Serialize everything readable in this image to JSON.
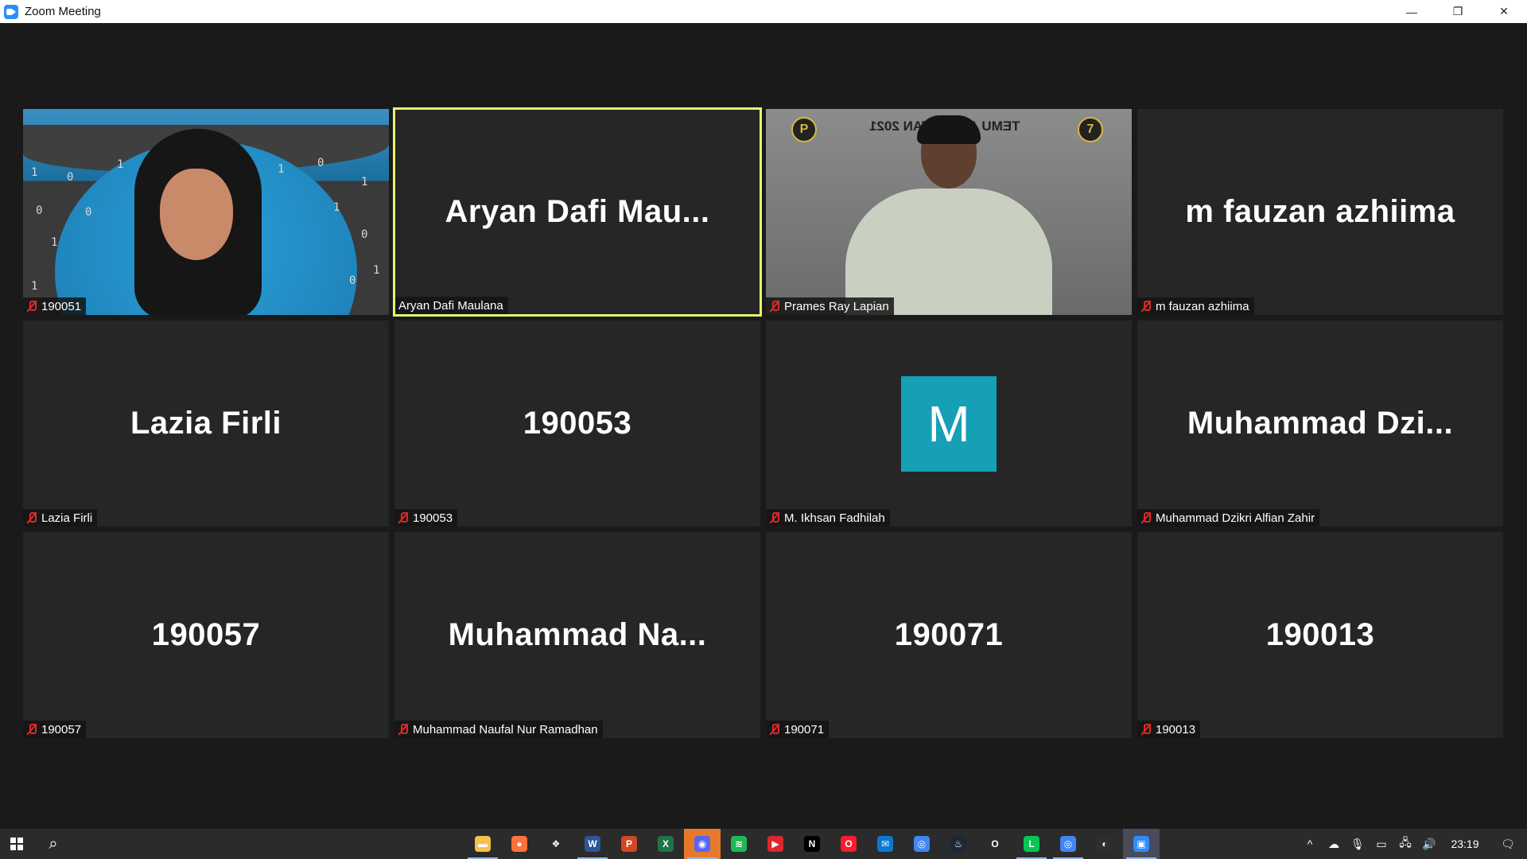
{
  "window": {
    "title": "Zoom Meeting",
    "controls": {
      "minimize": "—",
      "restore": "❐",
      "close": "✕"
    }
  },
  "participants": [
    {
      "big_label": "",
      "name": "190051",
      "type": "video",
      "muted": true
    },
    {
      "big_label": "Aryan  Dafi  Mau...",
      "name": "Aryan Dafi Maulana",
      "type": "name",
      "muted": false,
      "active_speaker": true
    },
    {
      "big_label": "",
      "name": "Prames Ray Lapian",
      "type": "video",
      "muted": true
    },
    {
      "big_label": "m fauzan azhiima",
      "name": "m fauzan azhiima",
      "type": "name",
      "muted": true
    },
    {
      "big_label": "Lazia Firli",
      "name": "Lazia Firli",
      "type": "name",
      "muted": true
    },
    {
      "big_label": "190053",
      "name": "190053",
      "type": "name",
      "muted": true
    },
    {
      "big_label": "M",
      "name": "M. Ikhsan Fadhilah",
      "type": "avatar",
      "muted": true
    },
    {
      "big_label": "Muhammad  Dzi...",
      "name": "Muhammad Dzikri Alfian Zahir",
      "type": "name",
      "muted": true
    },
    {
      "big_label": "190057",
      "name": "190057",
      "type": "name",
      "muted": true
    },
    {
      "big_label": "Muhammad  Na...",
      "name": "Muhammad Naufal Nur Ramadhan",
      "type": "name",
      "muted": true
    },
    {
      "big_label": "190071",
      "name": "190071",
      "type": "name",
      "muted": true
    },
    {
      "big_label": "190013",
      "name": "190013",
      "type": "name",
      "muted": true
    }
  ],
  "video_text": {
    "tile1_digits": [
      "1",
      "0",
      "1",
      "1",
      "0",
      "1",
      "0",
      "0",
      "1",
      "1",
      "0",
      "1",
      "1",
      "0"
    ],
    "tile3_banner": "TEMU ANGKATAN 2021",
    "tile3_badge_left": "P",
    "tile3_badge_right": "7"
  },
  "taskbar": {
    "apps": [
      {
        "name": "file-explorer-icon",
        "color": "#f2c14e",
        "glyph": "▬",
        "running": true
      },
      {
        "name": "firefox-icon",
        "color": "#ff7139",
        "glyph": "●",
        "running": false
      },
      {
        "name": "dropbox-icon",
        "color": "#2b2b2b",
        "glyph": "❖",
        "running": false
      },
      {
        "name": "word-icon",
        "color": "#2b579a",
        "glyph": "W",
        "running": true
      },
      {
        "name": "powerpoint-icon",
        "color": "#d24726",
        "glyph": "P",
        "running": false
      },
      {
        "name": "excel-icon",
        "color": "#217346",
        "glyph": "X",
        "running": false
      },
      {
        "name": "discord-icon",
        "color": "#5865f2",
        "glyph": "◉",
        "running": true,
        "highlight": true
      },
      {
        "name": "spotify-icon",
        "color": "#1db954",
        "glyph": "≋",
        "running": false
      },
      {
        "name": "media-player-icon",
        "color": "#e0262d",
        "glyph": "▶",
        "running": false
      },
      {
        "name": "netflix-icon",
        "color": "#000000",
        "glyph": "N",
        "running": false
      },
      {
        "name": "opera-icon",
        "color": "#ff1b2d",
        "glyph": "O",
        "running": false
      },
      {
        "name": "mail-icon",
        "color": "#0a78d4",
        "glyph": "✉",
        "running": false
      },
      {
        "name": "chrome-icon",
        "color": "#4285f4",
        "glyph": "◎",
        "running": false
      },
      {
        "name": "steam-icon",
        "color": "#1b2838",
        "glyph": "♨",
        "running": false
      },
      {
        "name": "opera-gx-icon",
        "color": "#2b2b2b",
        "glyph": "O",
        "running": false
      },
      {
        "name": "line-icon",
        "color": "#06c755",
        "glyph": "L",
        "running": true
      },
      {
        "name": "chrome-alt-icon",
        "color": "#4285f4",
        "glyph": "◎",
        "running": true
      },
      {
        "name": "obs-icon",
        "color": "#302e31",
        "glyph": "◐",
        "running": false
      },
      {
        "name": "zoom-icon",
        "color": "#2d8cff",
        "glyph": "▣",
        "running": true,
        "active": true
      }
    ],
    "tray": {
      "chevron": "^",
      "cloud": "☁",
      "mic": "🎙",
      "battery": "▭",
      "network": "🖧",
      "volume": "🔊",
      "time": "23:19",
      "notifications": "🗨"
    }
  }
}
